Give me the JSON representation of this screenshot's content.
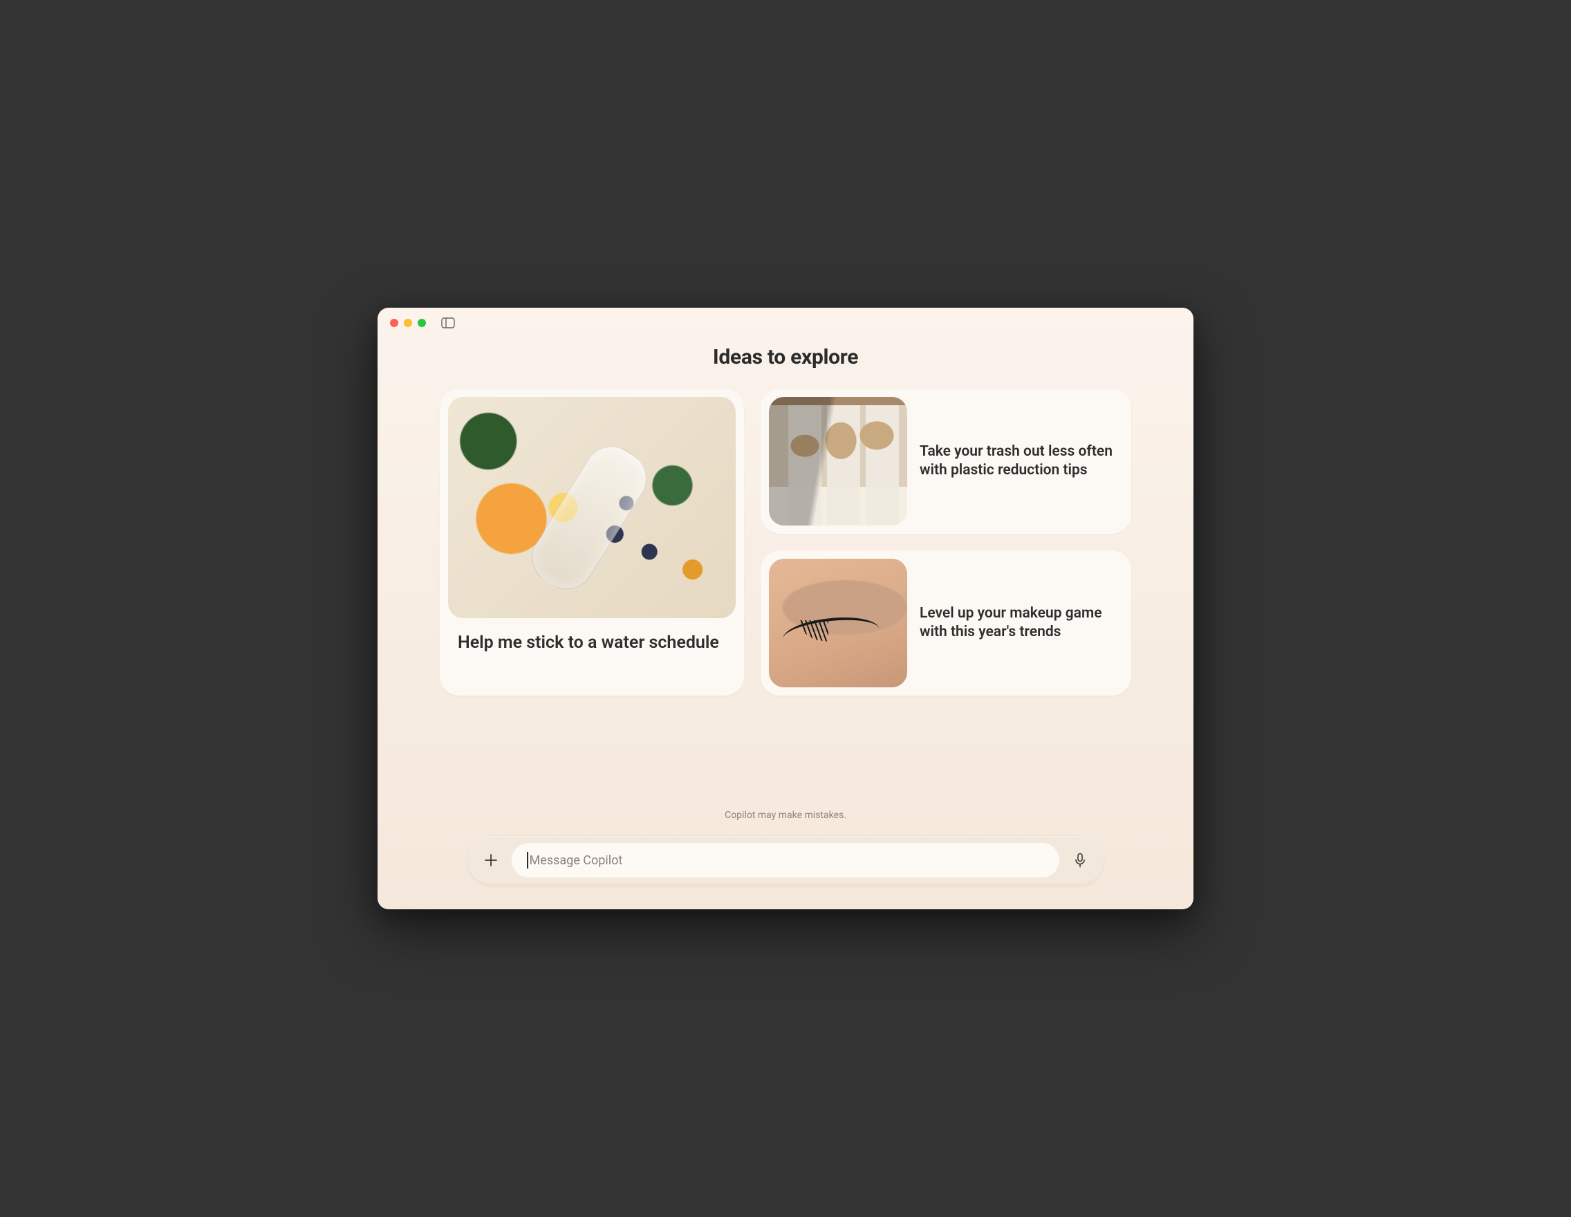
{
  "header": {
    "title": "Ideas to explore"
  },
  "cards": {
    "large": {
      "title": "Help me stick to a water schedule",
      "image_alt": "fruit-water-bottle"
    },
    "small1": {
      "title": "Take your trash out less often with plastic reduction tips",
      "image_alt": "jars-pantry"
    },
    "small2": {
      "title": "Level up your makeup game with this year's trends",
      "image_alt": "eye-makeup"
    }
  },
  "disclaimer": "Copilot may make mistakes.",
  "composer": {
    "placeholder": "Message Copilot"
  },
  "icons": {
    "sidebar": "sidebar-toggle-icon",
    "plus": "plus-icon",
    "mic": "mic-icon"
  }
}
